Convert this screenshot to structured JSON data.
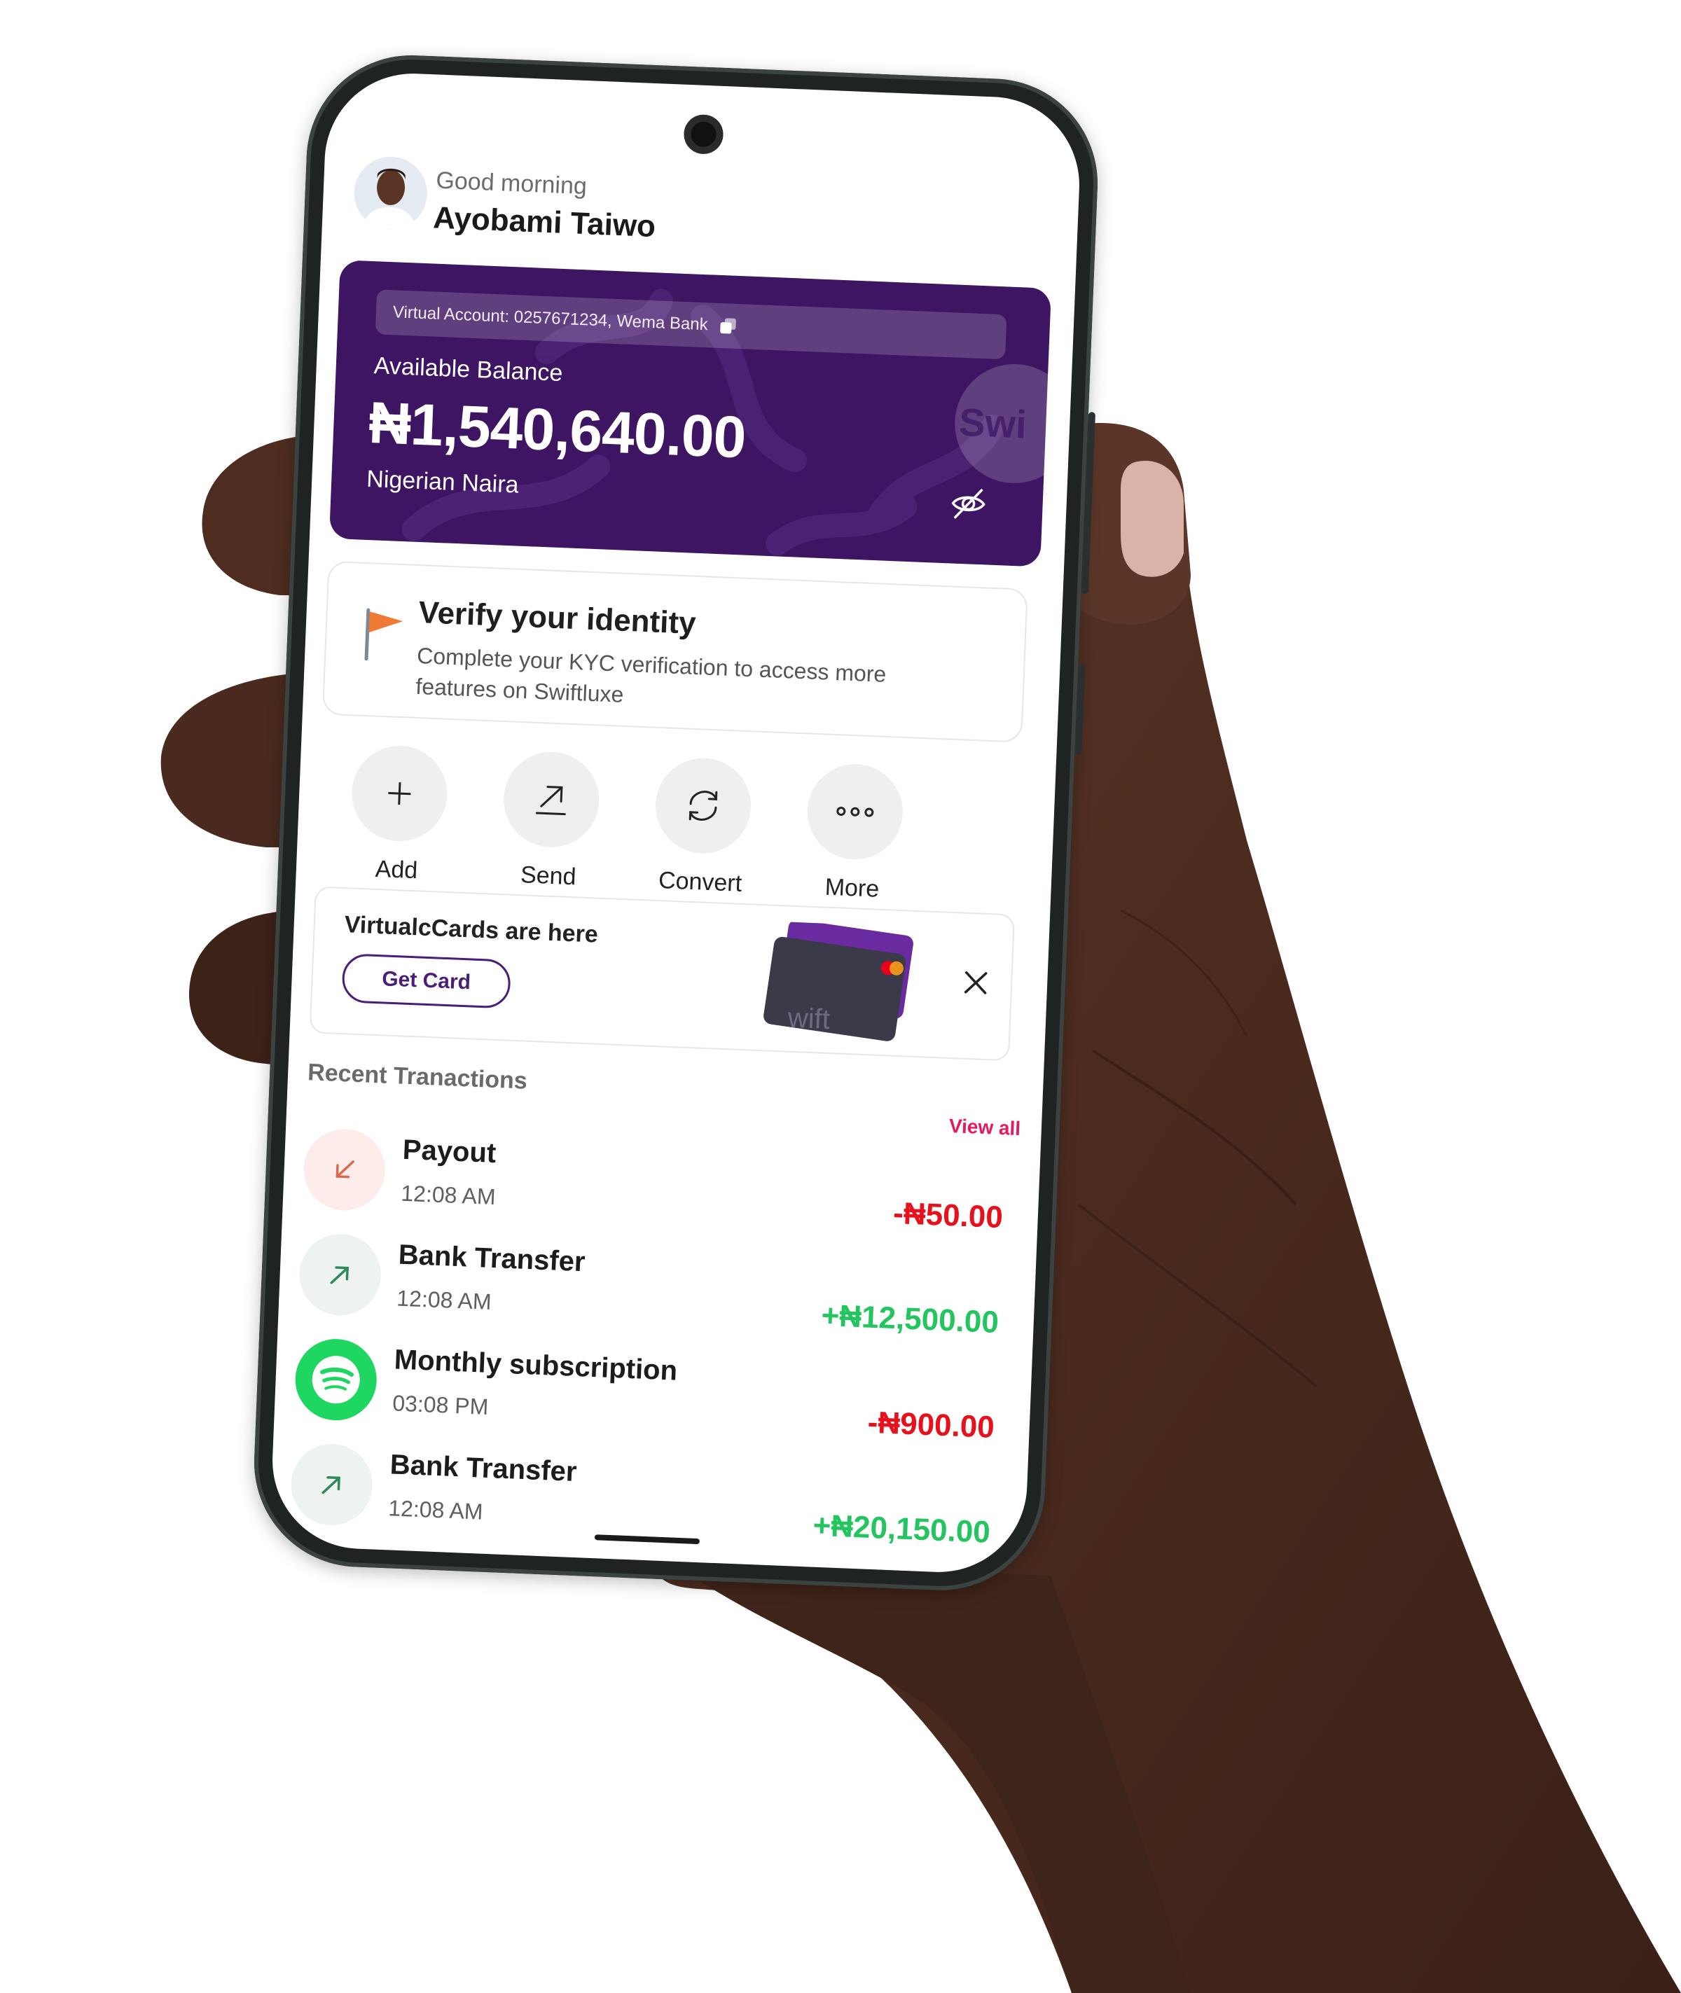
{
  "header": {
    "greeting": "Good morning",
    "username": "Ayobami Taiwo"
  },
  "balance_card": {
    "virtual_account": "Virtual Account: 0257671234, Wema Bank",
    "label": "Available Balance",
    "amount": "₦1,540,640.00",
    "currency": "Nigerian Naira",
    "brand_mark": "Swi",
    "background_color": "#3e1563"
  },
  "verify": {
    "title": "Verify your identity",
    "description": "Complete your KYC verification to access more features on Swiftluxe",
    "icon": "flag-icon",
    "icon_color": "#f07a35"
  },
  "actions": [
    {
      "label": "Add",
      "icon": "plus-icon"
    },
    {
      "label": "Send",
      "icon": "send-icon"
    },
    {
      "label": "Convert",
      "icon": "convert-icon"
    },
    {
      "label": "More",
      "icon": "more-icon"
    }
  ],
  "promo": {
    "title": "VirtualcCards are here",
    "button_label": "Get Card",
    "card_text": "wift",
    "accent_color": "#4b1d7a"
  },
  "transactions": {
    "section_title": "Recent Tranactions",
    "view_all_label": "View all",
    "items": [
      {
        "title": "Payout",
        "time": "12:08 AM",
        "amount": "-₦50.00",
        "icon": "arrow-down-left-icon",
        "direction": "debit"
      },
      {
        "title": "Bank Transfer",
        "time": "12:08 AM",
        "amount": "+₦12,500.00",
        "icon": "arrow-up-right-icon",
        "direction": "credit"
      },
      {
        "title": "Monthly subscription",
        "time": "03:08 PM",
        "amount": "-₦900.00",
        "icon": "spotify-icon",
        "direction": "debit"
      },
      {
        "title": "Bank Transfer",
        "time": "12:08 AM",
        "amount": "+₦20,150.00",
        "icon": "arrow-up-right-icon",
        "direction": "credit"
      }
    ]
  },
  "colors": {
    "debit": "#e8101a",
    "credit": "#22c55e",
    "link": "#e6195c",
    "spotify": "#1ed760"
  }
}
